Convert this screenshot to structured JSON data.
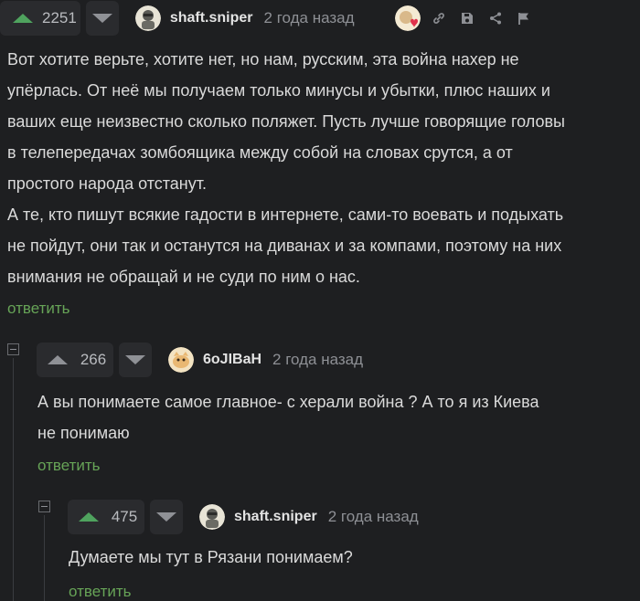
{
  "comment1": {
    "rating": "2251",
    "nick": "shaft.sniper",
    "time": "2 года назад",
    "text_lines": [
      "Вот хотите верьте, хотите нет, но нам, русским, эта война нахер не",
      "упёрлась. От неё мы получаем только минусы и убытки, плюс наших и",
      "ваших еще неизвестно сколько поляжет. Пусть лучше говорящие головы",
      "в телепередачах зомбоящика между собой на словах срутся, а от",
      "простого народа отстанут.",
      "А те, кто пишут всякие гадости в интернете, сами-то воевать и подыхать",
      "не пойдут, они так и останутся на диванах и за компами, поэтому на них",
      "внимания не обращай и не суди по ним о нас."
    ],
    "reply_label": "ответить",
    "icons": [
      "avatar-award-icon",
      "link-icon",
      "save-icon",
      "share-icon",
      "flag-icon"
    ]
  },
  "comment2": {
    "rating": "266",
    "nick": "6oJIBaH",
    "time": "2 года назад",
    "text_lines": [
      "А вы понимаете самое главное- с херали война ? А то я из Киева",
      "не понимаю"
    ],
    "reply_label": "ответить"
  },
  "comment3": {
    "rating": "475",
    "nick": "shaft.sniper",
    "time": "2 года назад",
    "text_lines": [
      "Думаете мы тут в Рязани понимаем?"
    ],
    "reply_label": "ответить"
  },
  "colors": {
    "background": "#1e1f21",
    "positive_vote": "#4fa35e",
    "reply_link": "#67a457"
  }
}
